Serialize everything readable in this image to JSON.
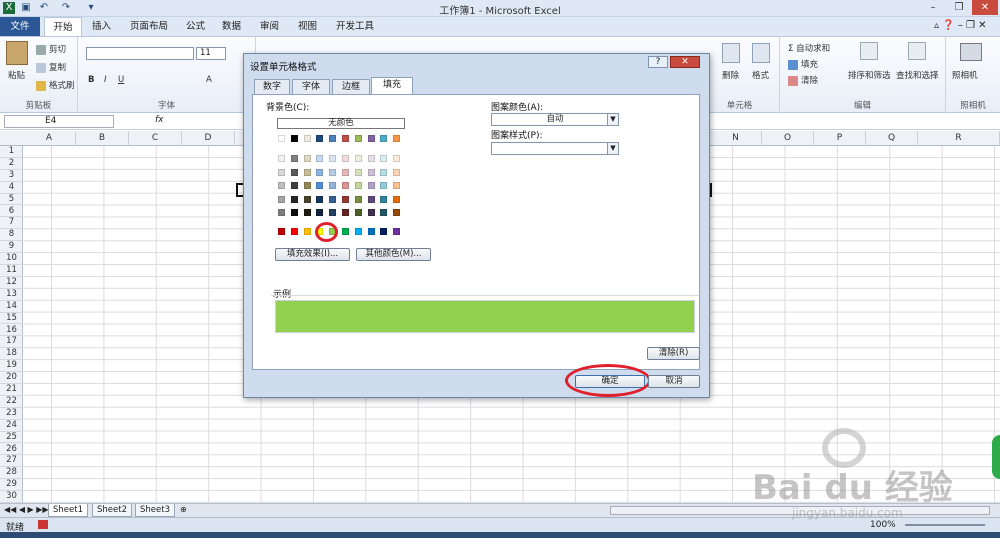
{
  "window": {
    "title": "工作簿1 - Microsoft Excel"
  },
  "ribbon_tabs": [
    "文件",
    "开始",
    "插入",
    "页面布局",
    "公式",
    "数据",
    "审阅",
    "视图",
    "开发工具"
  ],
  "ribbon": {
    "clipboard": {
      "paste": "粘贴",
      "cut": "剪切",
      "copy": "复制",
      "format_painter": "格式刷",
      "label": "剪贴板"
    },
    "font": {
      "size": "11",
      "label": "字体"
    },
    "cells": {
      "delete": "删除",
      "format": "格式",
      "label": "单元格"
    },
    "editing": {
      "autosum": "Σ 自动求和",
      "fill": "填充",
      "clear": "清除",
      "sort_filter": "排序和筛选",
      "find_select": "查找和选择",
      "label": "编辑"
    },
    "camera": {
      "button": "照相机",
      "label": "照相机"
    }
  },
  "formula_bar": {
    "name_box": "E4",
    "fx": "fx"
  },
  "columns": [
    "A",
    "B",
    "C",
    "D",
    "",
    "",
    "",
    "",
    "",
    "",
    "",
    "",
    "",
    "N",
    "O",
    "P",
    "Q",
    "R"
  ],
  "rows": [
    "1",
    "2",
    "3",
    "4",
    "5",
    "6",
    "7",
    "8",
    "9",
    "10",
    "11",
    "12",
    "13",
    "14",
    "15",
    "16",
    "17",
    "18",
    "19",
    "20",
    "21",
    "22",
    "23",
    "24",
    "25",
    "26",
    "27",
    "28",
    "29",
    "30"
  ],
  "sheets": [
    "Sheet1",
    "Sheet2",
    "Sheet3"
  ],
  "status": {
    "left": "就绪",
    "zoom": "100%"
  },
  "dialog": {
    "title": "设置单元格格式",
    "tabs": [
      "数字",
      "字体",
      "边框",
      "填充"
    ],
    "bg_color_label": "背景色(C):",
    "no_color": "无颜色",
    "fill_effects": "填充效果(I)...",
    "more_colors": "其他颜色(M)...",
    "pattern_color_label": "图案颜色(A):",
    "pattern_color_value": "自动",
    "pattern_style_label": "图案样式(P):",
    "pattern_style_value": "",
    "sample_label": "示例",
    "sample_color": "#92d050",
    "clear": "清除(R)",
    "ok": "确定",
    "cancel": "取消"
  },
  "palette": {
    "theme_top": [
      "#ffffff",
      "#000000",
      "#eeece1",
      "#1f497d",
      "#4f81bd",
      "#c0504d",
      "#9bbb59",
      "#8064a2",
      "#4bacc6",
      "#f79646"
    ],
    "theme_rows": [
      [
        "#f2f2f2",
        "#7f7f7f",
        "#ddd9c3",
        "#c6d9f0",
        "#dbe5f1",
        "#f2dcdb",
        "#ebf1dd",
        "#e5e0ec",
        "#dbeef3",
        "#fdeada"
      ],
      [
        "#d8d8d8",
        "#595959",
        "#c4bd97",
        "#8db3e2",
        "#b8cce4",
        "#e5b9b7",
        "#d7e3bc",
        "#ccc1d9",
        "#b7dde8",
        "#fbd5b5"
      ],
      [
        "#bfbfbf",
        "#3f3f3f",
        "#938953",
        "#548dd4",
        "#95b3d7",
        "#d99694",
        "#c3d69b",
        "#b2a2c7",
        "#92cddc",
        "#fac08f"
      ],
      [
        "#a5a5a5",
        "#262626",
        "#494429",
        "#17365d",
        "#366092",
        "#953734",
        "#76923c",
        "#5f497a",
        "#31859b",
        "#e36c09"
      ],
      [
        "#7f7f7f",
        "#0c0c0c",
        "#1d1b10",
        "#0f243e",
        "#244061",
        "#632423",
        "#4f6128",
        "#3f3151",
        "#205867",
        "#974806"
      ]
    ],
    "standard": [
      "#c00000",
      "#ff0000",
      "#ffc000",
      "#ffff00",
      "#92d050",
      "#00b050",
      "#00b0f0",
      "#0070c0",
      "#002060",
      "#7030a0"
    ]
  },
  "watermark": {
    "brand": "Bai du 经验",
    "url": "jingyan.baidu.com"
  }
}
